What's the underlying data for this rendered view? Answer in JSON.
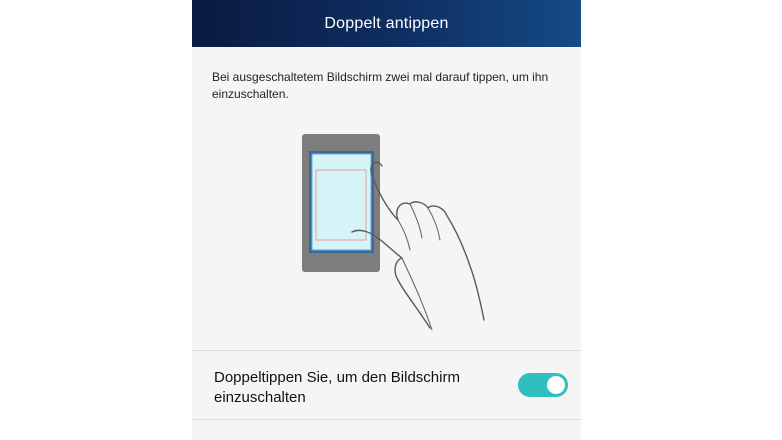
{
  "header": {
    "title": "Doppelt antippen",
    "gradient_colors": [
      "#0a1a40",
      "#154b86"
    ]
  },
  "description": {
    "text": "Bei ausgeschaltetem Bildschirm zwei mal darauf tippen, um ihn einzuschalten."
  },
  "illustration": {
    "icon": "double-tap-phone-hand-icon"
  },
  "setting": {
    "label": "Doppeltippen Sie, um den Bildschirm einzuschalten",
    "toggle_state": "on",
    "toggle_color": "#2fbfbf"
  }
}
